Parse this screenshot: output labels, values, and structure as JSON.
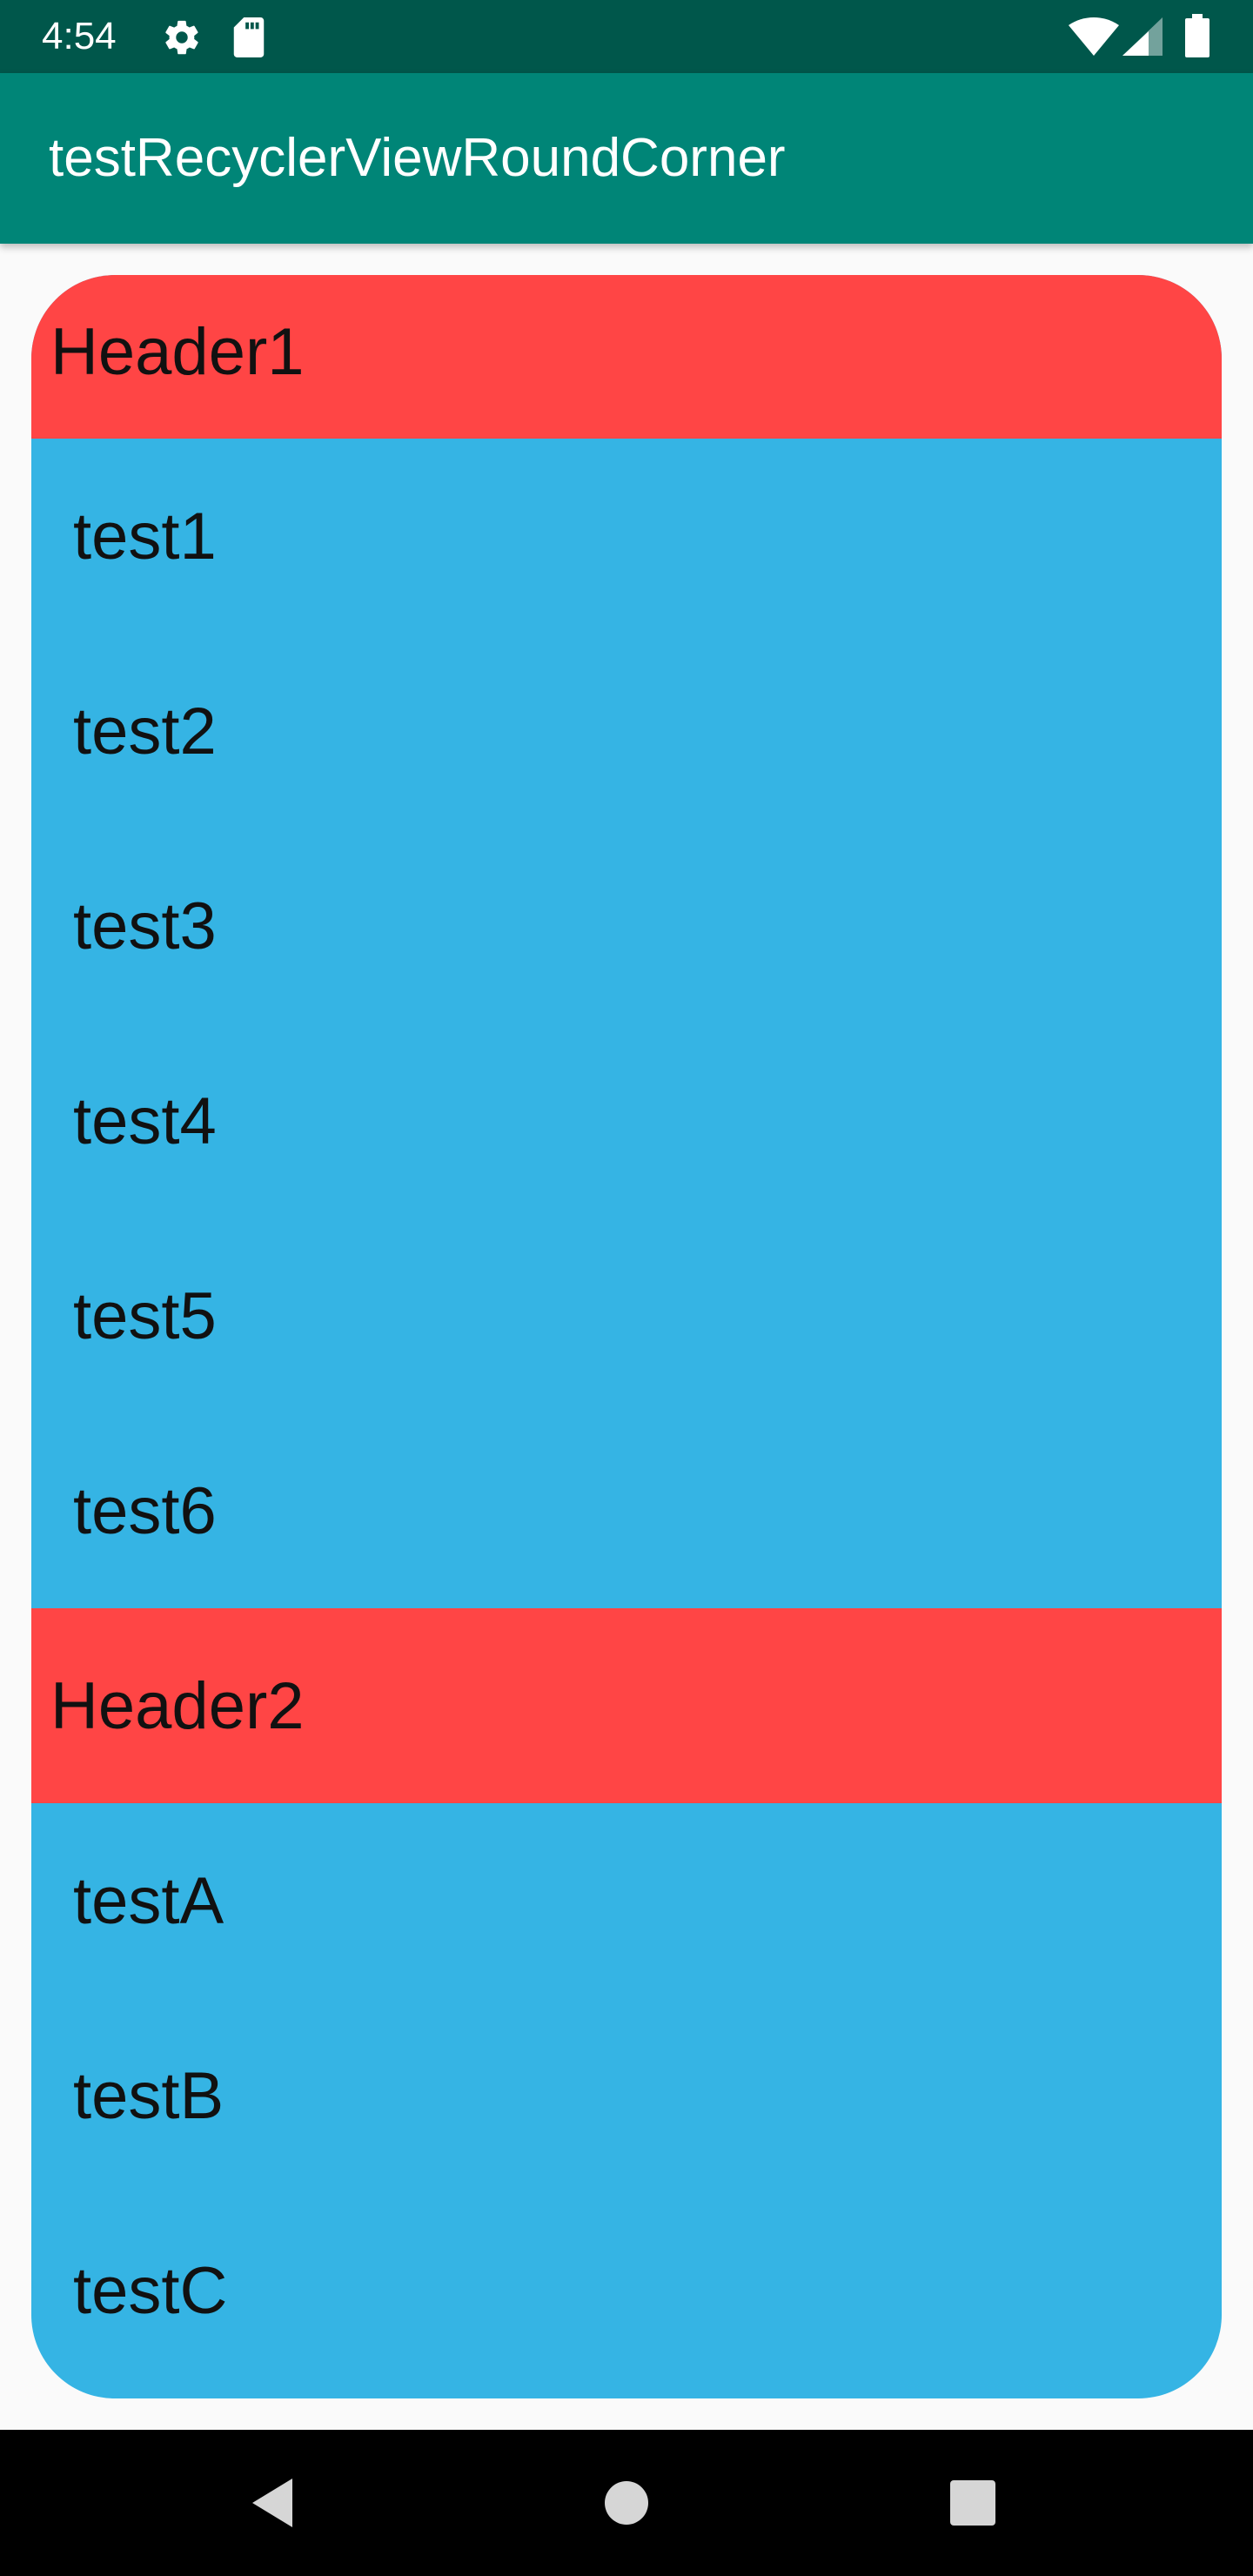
{
  "status_bar": {
    "time": "4:54",
    "icons": [
      "settings-icon",
      "sd-card-icon",
      "wifi-icon",
      "cell-signal-icon",
      "battery-icon"
    ],
    "background": "#00574b"
  },
  "app_bar": {
    "title": "testRecyclerViewRoundCorner",
    "background": "#008577"
  },
  "list": {
    "header_color": "#ff4545",
    "item_color": "#35b4e4",
    "sections": [
      {
        "header": "Header1",
        "items": [
          "test1",
          "test2",
          "test3",
          "test4",
          "test5",
          "test6"
        ]
      },
      {
        "header": "Header2",
        "items": [
          "testA",
          "testB",
          "testC"
        ]
      }
    ]
  },
  "nav_bar": {
    "buttons": [
      "back-icon",
      "home-icon",
      "recents-icon"
    ]
  }
}
